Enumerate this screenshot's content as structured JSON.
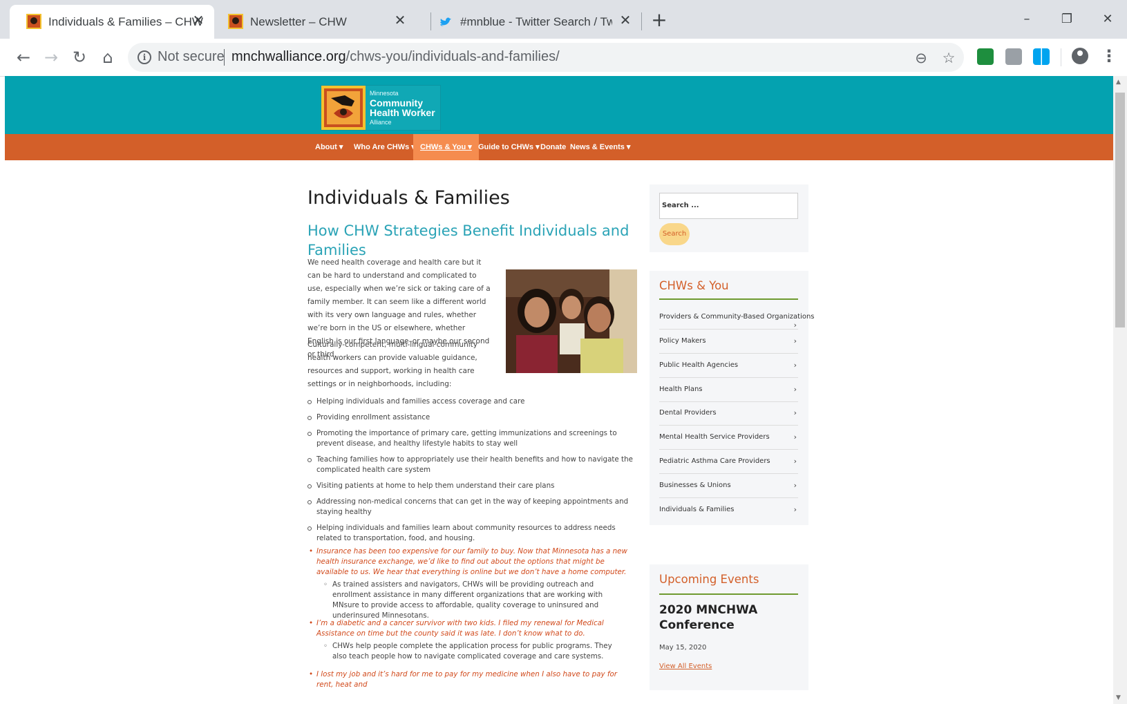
{
  "browser": {
    "tabs": [
      {
        "title": "Individuals & Families – CHW",
        "active": true,
        "favicon": "chw-logo-icon"
      },
      {
        "title": "Newsletter – CHW",
        "active": false,
        "favicon": "chw-logo-icon"
      },
      {
        "title": "#mnblue - Twitter Search / Twitte",
        "active": false,
        "favicon": "twitter-bird-icon"
      }
    ],
    "new_tab": "+",
    "window_controls": {
      "minimize": "–",
      "restore": "❐",
      "close": "✕"
    },
    "nav": {
      "back": "←",
      "forward": "→",
      "reload": "↻",
      "home": "⌂"
    },
    "omnibox": {
      "security_label": "Not secure",
      "url_domain": "mnchwalliance.org",
      "url_path": "/chws-you/individuals-and-families/"
    },
    "toolbar_icons": [
      "zoom-out-icon",
      "bookmark-star-icon",
      "extension-icon",
      "extension-icon",
      "windows-extension-icon",
      "profile-icon",
      "menu-icon"
    ]
  },
  "site": {
    "logo": {
      "line1": "Minnesota",
      "line2": "Community",
      "line3": "Health Worker",
      "line4": "Alliance"
    },
    "nav": [
      {
        "label": "About ▾",
        "active": false
      },
      {
        "label": "Who Are CHWs ▾",
        "active": false
      },
      {
        "label": "CHWs & You ▾",
        "active": true
      },
      {
        "label": "Guide to CHWs ▾",
        "active": false
      },
      {
        "label": "Donate",
        "active": false
      },
      {
        "label": "News & Events ▾",
        "active": false
      }
    ],
    "colors": {
      "header_teal": "#04a2b0",
      "nav_orange": "#d35f29",
      "nav_active": "#f58c4f",
      "accent_green": "#6e9a2f",
      "quote_red": "#d14a1c"
    }
  },
  "article": {
    "title": "Individuals & Families",
    "subtitle": "How CHW Strategies Benefit Individuals and Families",
    "intro": "We need health coverage and health care but it can be hard to understand and complicated to use, especially when we’re sick or taking care of a family member. It can seem like a different world with its very own language and rules, whether we’re born in the US or elsewhere, whether English is our first language–or maybe our second or third.",
    "para2": "Culturally-competent, multi-lingual community health workers can provide valuable guidance, resources and support, working in health care settings or in neighborhoods, including:",
    "benefits": [
      "Helping individuals and families access coverage and care",
      "Providing enrollment assistance",
      "Promoting the importance of primary care, getting immunizations and screenings to prevent disease, and healthy lifestyle habits to stay well",
      "Teaching families how to appropriately use their health benefits and how to navigate the complicated health care system",
      "Visiting patients at home to help them understand their care plans",
      "Addressing non-medical concerns that can get in the way of keeping appointments and staying healthy",
      "Helping individuals and families learn about community resources to address needs related to transportation, food, and housing."
    ],
    "quotes": [
      {
        "quote": "Insurance has been too expensive for our family to buy.  Now that Minnesota has a new health insurance exchange, we’d like to find out about the options that might be available to us.  We hear that everything is online but we don’t have a home computer.",
        "answer": "As trained assisters and navigators, CHWs will be providing outreach and enrollment assistance in many different organizations that are working with MNsure to provide access to affordable, quality coverage to uninsured and underinsured Minnesotans."
      },
      {
        "quote": "I’m a diabetic and a cancer survivor with two kids.  I filed my renewal for Medical Assistance on time but the county said it was late.  I don’t know what to do.",
        "answer": "CHWs help people complete the application process for public programs.  They also teach people how to navigate complicated coverage and care systems."
      },
      {
        "quote": "I lost my job and it’s hard for me to pay for my medicine when I also have to pay for rent, heat and",
        "answer": ""
      }
    ]
  },
  "sidebar": {
    "search": {
      "placeholder": "Search ...",
      "button": "Search"
    },
    "chws_you": {
      "title": "CHWs & You",
      "items": [
        "Providers & Community-Based Organizations",
        "Policy Makers",
        "Public Health Agencies",
        "Health Plans",
        "Dental Providers",
        "Mental Health Service Providers",
        "Pediatric Asthma Care Providers",
        "Businesses & Unions",
        "Individuals & Families"
      ]
    },
    "events": {
      "title": "Upcoming Events",
      "event_title": "2020 MNCHWA Conference",
      "event_date": "May 15, 2020",
      "view_all": "View All Events"
    }
  }
}
